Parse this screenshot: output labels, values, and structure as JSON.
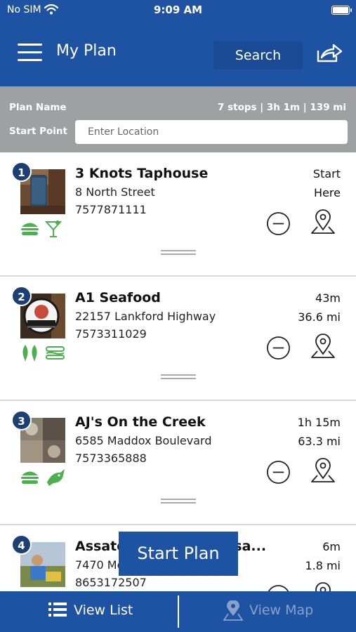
{
  "status_bar": {
    "carrier": "No SIM",
    "time": "9:09 AM"
  },
  "header": {
    "title": "My Plan",
    "search_label": "Search"
  },
  "plan": {
    "name_label": "Plan Name",
    "summary": "7 stops | 3h 1m | 139 mi",
    "start_label": "Start Point",
    "location_placeholder": "Enter Location"
  },
  "stops": [
    {
      "number": "1",
      "name": "3 Knots Taphouse",
      "address": "8 North Street",
      "phone": "7577871111",
      "meta_line1": "Start",
      "meta_line2": "Here",
      "amenities": [
        "burger-icon",
        "cocktail-icon"
      ]
    },
    {
      "number": "2",
      "name": "A1 Seafood",
      "address": "22157 Lankford Highway",
      "phone": "7573311029",
      "meta_line1": "43m",
      "meta_line2": "36.6 mi",
      "amenities": [
        "seafood-icon",
        "sandwich-icon"
      ]
    },
    {
      "number": "3",
      "name": "AJ's On the Creek",
      "address": "6585 Maddox Boulevard",
      "phone": "7573365888",
      "meta_line1": "1h 15m",
      "meta_line2": "63.3 mi",
      "amenities": [
        "burger-icon",
        "fish-icon"
      ]
    },
    {
      "number": "4",
      "name": "Assate",
      "name_tail": "– Assa...",
      "address": "7470 Me",
      "phone": "8653172507",
      "meta_line1": "6m",
      "meta_line2": "1.8 mi",
      "amenities": []
    }
  ],
  "start_plan_label": "Start Plan",
  "bottom_tabs": {
    "list_label": "View List",
    "map_label": "View Map"
  },
  "colors": {
    "brand_blue": "#1e52a3",
    "dark_blue": "#1d3f73",
    "green": "#4caf50",
    "plan_bar_gray": "#9ea0a2"
  }
}
